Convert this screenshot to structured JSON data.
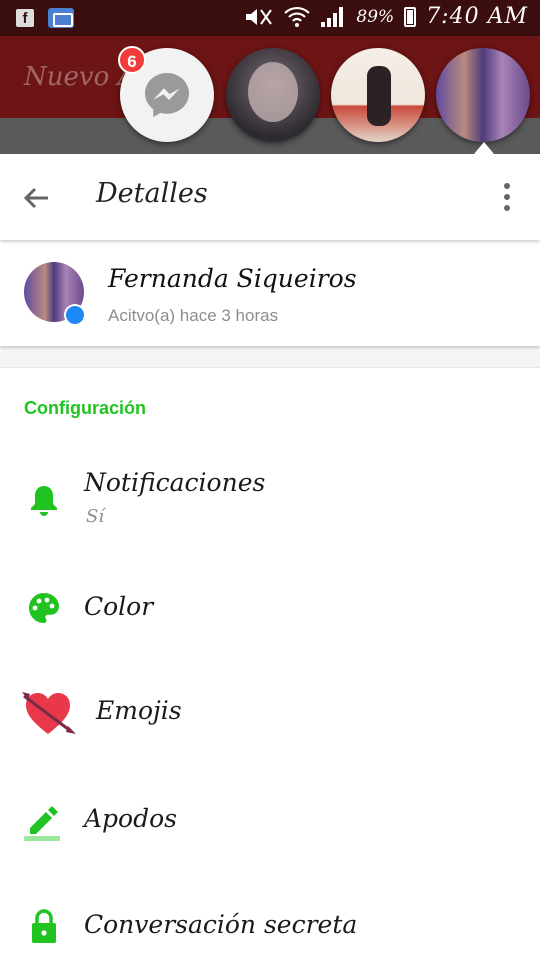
{
  "status_bar": {
    "battery": "89%",
    "time": "7:40 AM",
    "fb_letter": "f"
  },
  "background_app": {
    "title": "Nuevo A"
  },
  "chat_heads": {
    "unread_count": "6"
  },
  "toolbar": {
    "title": "Detalles"
  },
  "profile": {
    "name": "Fernanda Siqueiros",
    "status": "Acitvo(a) hace 3 horas"
  },
  "settings": {
    "header": "Configuración",
    "items": [
      {
        "label": "Notificaciones",
        "sub": "Sí",
        "icon": "bell-icon"
      },
      {
        "label": "Color",
        "icon": "palette-icon"
      },
      {
        "label": "Emojis",
        "icon": "heart-arrow-icon"
      },
      {
        "label": "Apodos",
        "icon": "pencil-icon"
      },
      {
        "label": "Conversación secreta",
        "icon": "lock-icon"
      }
    ]
  },
  "colors": {
    "accent": "#21c321",
    "statusbar": "#3a0e0e",
    "appbar": "#6d1414",
    "badge": "#f43b3b",
    "messenger_badge": "#1e88f5"
  }
}
